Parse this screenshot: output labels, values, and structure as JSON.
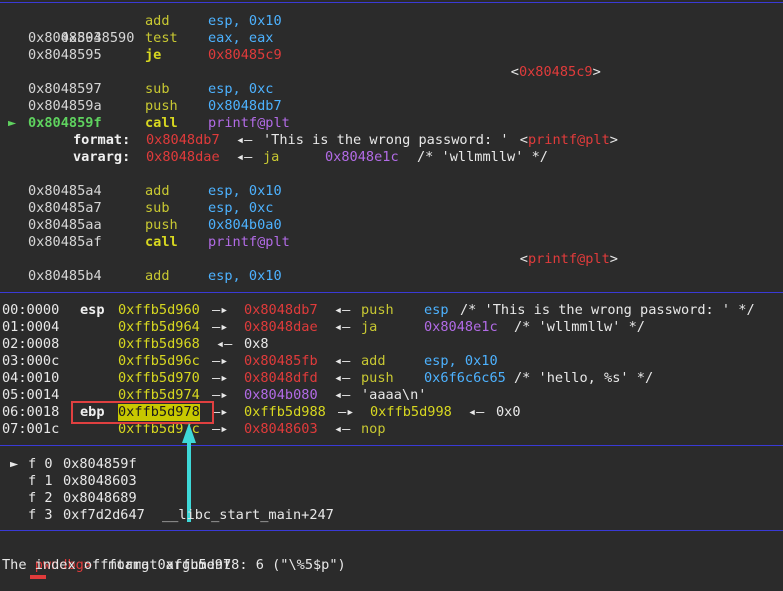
{
  "disasm": [
    {
      "addr": "0x8048590",
      "mnem": "add",
      "ops": "esp, 0x10"
    },
    {
      "addr": "0x8048593",
      "mnem": "test",
      "ops": "eax, eax"
    },
    {
      "addr": "0x8048595",
      "mnem": "je",
      "ops": "0x80485c9",
      "target": "<0x80485c9>"
    },
    {
      "addr": "0x8048597",
      "mnem": "sub",
      "ops": "esp, 0xc"
    },
    {
      "addr": "0x804859a",
      "mnem": "push",
      "ops": "0x8048db7"
    },
    {
      "addr": "0x804859f",
      "mnem": "call",
      "ops": "printf@plt",
      "target": "<printf@plt>",
      "current": true
    },
    {
      "addr": "0x80485a4",
      "mnem": "add",
      "ops": "esp, 0x10"
    },
    {
      "addr": "0x80485a7",
      "mnem": "sub",
      "ops": "esp, 0xc"
    },
    {
      "addr": "0x80485aa",
      "mnem": "push",
      "ops": "0x804b0a0"
    },
    {
      "addr": "0x80485af",
      "mnem": "call",
      "ops": "printf@plt",
      "target": "<printf@plt>"
    },
    {
      "addr": "0x80485b4",
      "mnem": "add",
      "ops": "esp, 0x10"
    }
  ],
  "args": {
    "format": {
      "label": "format:",
      "ptr": "0x8048db7",
      "value": "'This is the wrong password: '"
    },
    "vararg": {
      "label": "vararg:",
      "ptr": "0x8048dae",
      "instr": "ja",
      "addr": "0x8048e1c",
      "comment": "/* 'wllmmllw' */"
    }
  },
  "arrow_sym": "◂—",
  "ptr_sym": "—▸",
  "cur_marker": "►",
  "stack": [
    {
      "off": "00:0000",
      "reg": "esp",
      "addr": "0xffb5d960",
      "p1": "0x8048db7",
      "tail_instr": "push",
      "tail_op": "esp",
      "tail_comment": "/* 'This is the wrong password: ' */"
    },
    {
      "off": "01:0004",
      "reg": "",
      "addr": "0xffb5d964",
      "p1": "0x8048dae",
      "tail_instr": "ja",
      "tail_op": "0x8048e1c",
      "tail_comment": "/* 'wllmmllw' */"
    },
    {
      "off": "02:0008",
      "reg": "",
      "addr": "0xffb5d968",
      "val": "0x8"
    },
    {
      "off": "03:000c",
      "reg": "",
      "addr": "0xffb5d96c",
      "p1": "0x80485fb",
      "tail_instr": "add",
      "tail_op": "esp, 0x10"
    },
    {
      "off": "04:0010",
      "reg": "",
      "addr": "0xffb5d970",
      "p1": "0x8048dfd",
      "tail_instr": "push",
      "tail_op": "0x6f6c6c65",
      "tail_comment": "/* 'hello, %s' */"
    },
    {
      "off": "05:0014",
      "reg": "",
      "addr": "0xffb5d974",
      "p1": "0x804b080",
      "str": "'aaaa\\n'"
    },
    {
      "off": "06:0018",
      "reg": "ebp",
      "addr": "0xffb5d978",
      "p1": "0xffb5d988",
      "p2": "0xffb5d998",
      "val": "0x0"
    },
    {
      "off": "07:001c",
      "reg": "",
      "addr": "0xffb5d97c",
      "p1": "0x8048603",
      "tail_instr": "nop"
    }
  ],
  "backtrace": [
    {
      "frame": "f 0",
      "addr": "0x804859f",
      "sym": "",
      "current": true
    },
    {
      "frame": "f 1",
      "addr": "0x8048603",
      "sym": ""
    },
    {
      "frame": "f 2",
      "addr": "0x8048689",
      "sym": ""
    },
    {
      "frame": "f 3",
      "addr": "0xf7d2d647",
      "sym": "__libc_start_main+247"
    }
  ],
  "console": {
    "prompt": "pwndbg>",
    "command": " fmtarg 0xffb5d978",
    "output": "The index of format argument : 6 (\"\\%5$p\")"
  },
  "colors": {
    "background": "#2b2b2b",
    "separator": "#3a3ad6",
    "highlight_box": "#e04040",
    "annotation_arrow": "#3ed8d8"
  }
}
